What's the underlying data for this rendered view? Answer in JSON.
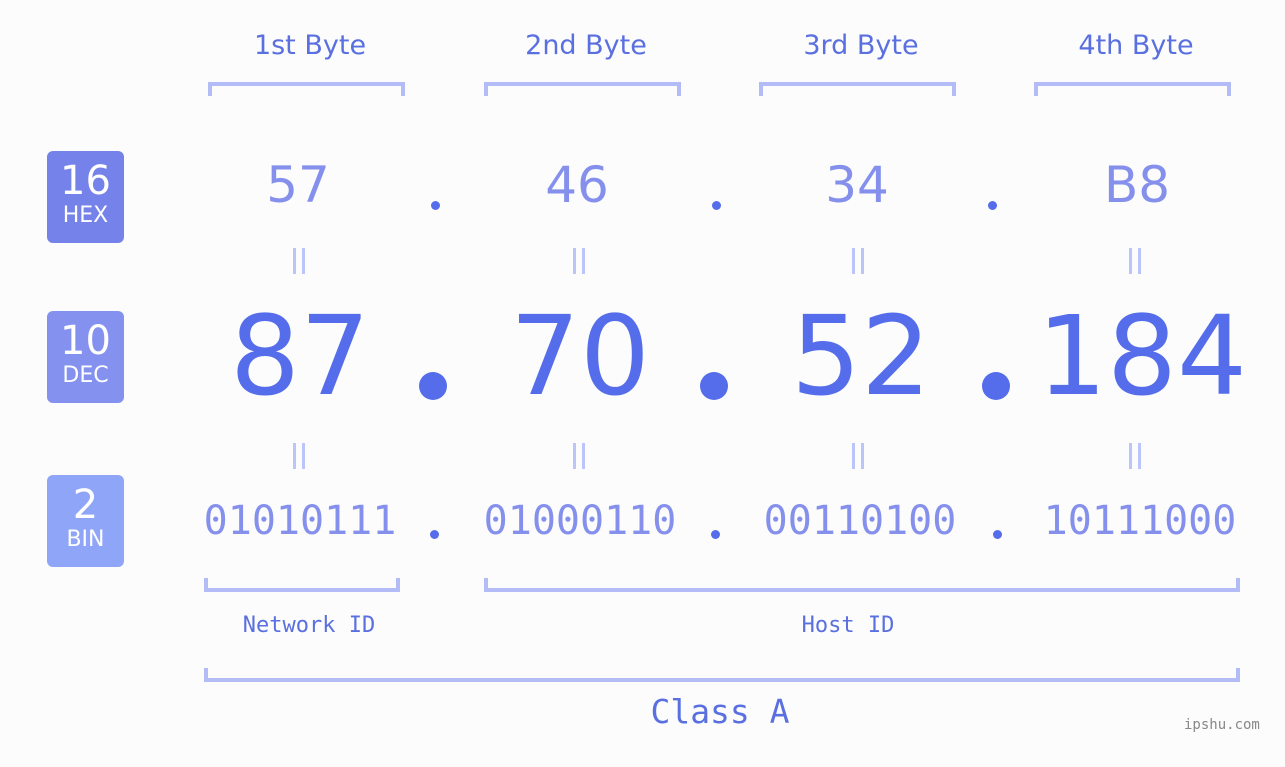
{
  "bytes": {
    "headers": [
      "1st Byte",
      "2nd Byte",
      "3rd Byte",
      "4th Byte"
    ]
  },
  "badges": {
    "hex": {
      "num": "16",
      "label": "HEX",
      "color": "#7582ea"
    },
    "dec": {
      "num": "10",
      "label": "DEC",
      "color": "#8491ef"
    },
    "bin": {
      "num": "2",
      "label": "BIN",
      "color": "#8fa5f7"
    }
  },
  "hex": {
    "values": [
      "57",
      "46",
      "34",
      "B8"
    ],
    "separator": "."
  },
  "dec": {
    "values": [
      "87",
      "70",
      "52",
      "184"
    ],
    "separator": "."
  },
  "bin": {
    "values": [
      "01010111",
      "01000110",
      "00110100",
      "10111000"
    ],
    "separator": "."
  },
  "segments": {
    "network_label": "Network ID",
    "host_label": "Host ID",
    "class_label": "Class A"
  },
  "colors": {
    "accent": "#556ceb",
    "light": "#8490ec",
    "bracket": "#b3bcf6"
  },
  "watermark": "ipshu.com"
}
